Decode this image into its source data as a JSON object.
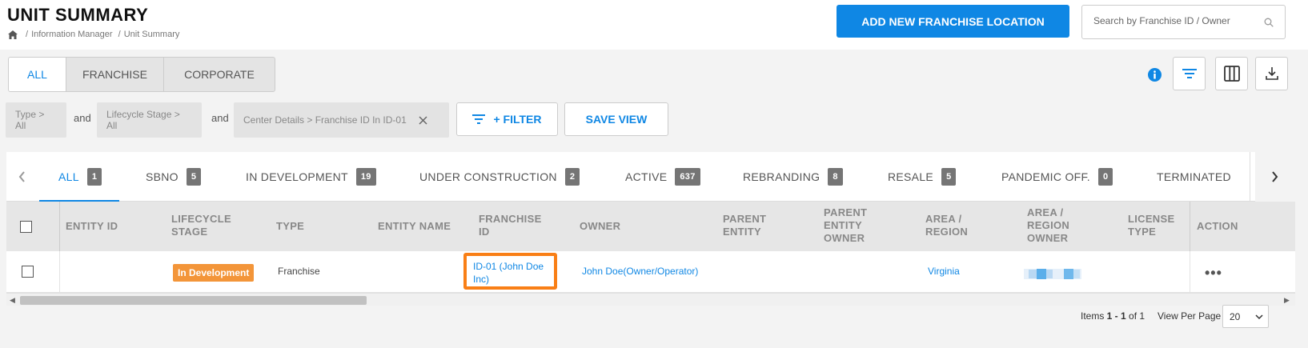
{
  "header": {
    "title": "UNIT SUMMARY",
    "breadcrumb": [
      "Information Manager",
      "Unit Summary"
    ],
    "add_button": "ADD NEW FRANCHISE LOCATION",
    "search_placeholder": "Search by Franchise ID / Owner"
  },
  "segments": [
    {
      "label": "ALL",
      "active": true
    },
    {
      "label": "FRANCHISE",
      "active": false
    },
    {
      "label": "CORPORATE",
      "active": false
    }
  ],
  "toolbar_icons": [
    "info-icon",
    "filter-icon",
    "columns-icon",
    "download-icon"
  ],
  "filters": {
    "chips": [
      "Type > All",
      "Lifecycle Stage > All",
      "Center Details > Franchise ID In ID-01"
    ],
    "conjunction": "and",
    "filter_button": "+ FILTER",
    "save_view_button": "SAVE VIEW"
  },
  "tabs": [
    {
      "label": "ALL",
      "count": "1",
      "active": true
    },
    {
      "label": "SBNO",
      "count": "5"
    },
    {
      "label": "IN DEVELOPMENT",
      "count": "19"
    },
    {
      "label": "UNDER CONSTRUCTION",
      "count": "2"
    },
    {
      "label": "ACTIVE",
      "count": "637"
    },
    {
      "label": "REBRANDING",
      "count": "8"
    },
    {
      "label": "RESALE",
      "count": "5"
    },
    {
      "label": "PANDEMIC OFF.",
      "count": "0"
    },
    {
      "label": "TERMINATED",
      "count": ""
    }
  ],
  "table": {
    "columns": [
      "ENTITY ID",
      "LIFECYCLE STAGE",
      "TYPE",
      "ENTITY NAME",
      "FRANCHISE ID",
      "OWNER",
      "PARENT ENTITY",
      "PARENT ENTITY OWNER",
      "AREA / REGION",
      "AREA / REGION OWNER",
      "LICENSE TYPE",
      "ACTION"
    ],
    "rows": [
      {
        "entity_id": "",
        "lifecycle_stage": "In Development",
        "type": "Franchise",
        "entity_name": "",
        "franchise_id": "ID-01 (John Doe Inc)",
        "owner": "John Doe(Owner/Operator)",
        "parent_entity": "",
        "parent_entity_owner": "",
        "area_region": "Virginia",
        "license_type": "",
        "action": "•••"
      }
    ]
  },
  "footer": {
    "items_prefix": "Items ",
    "items_range": "1 - 1",
    "items_suffix": " of 1",
    "view_per_page_label": "View Per Page",
    "view_per_page_value": "20"
  },
  "colors": {
    "accent": "#0f87e4",
    "badge_orange": "#f39539",
    "highlight": "#f97f16"
  }
}
